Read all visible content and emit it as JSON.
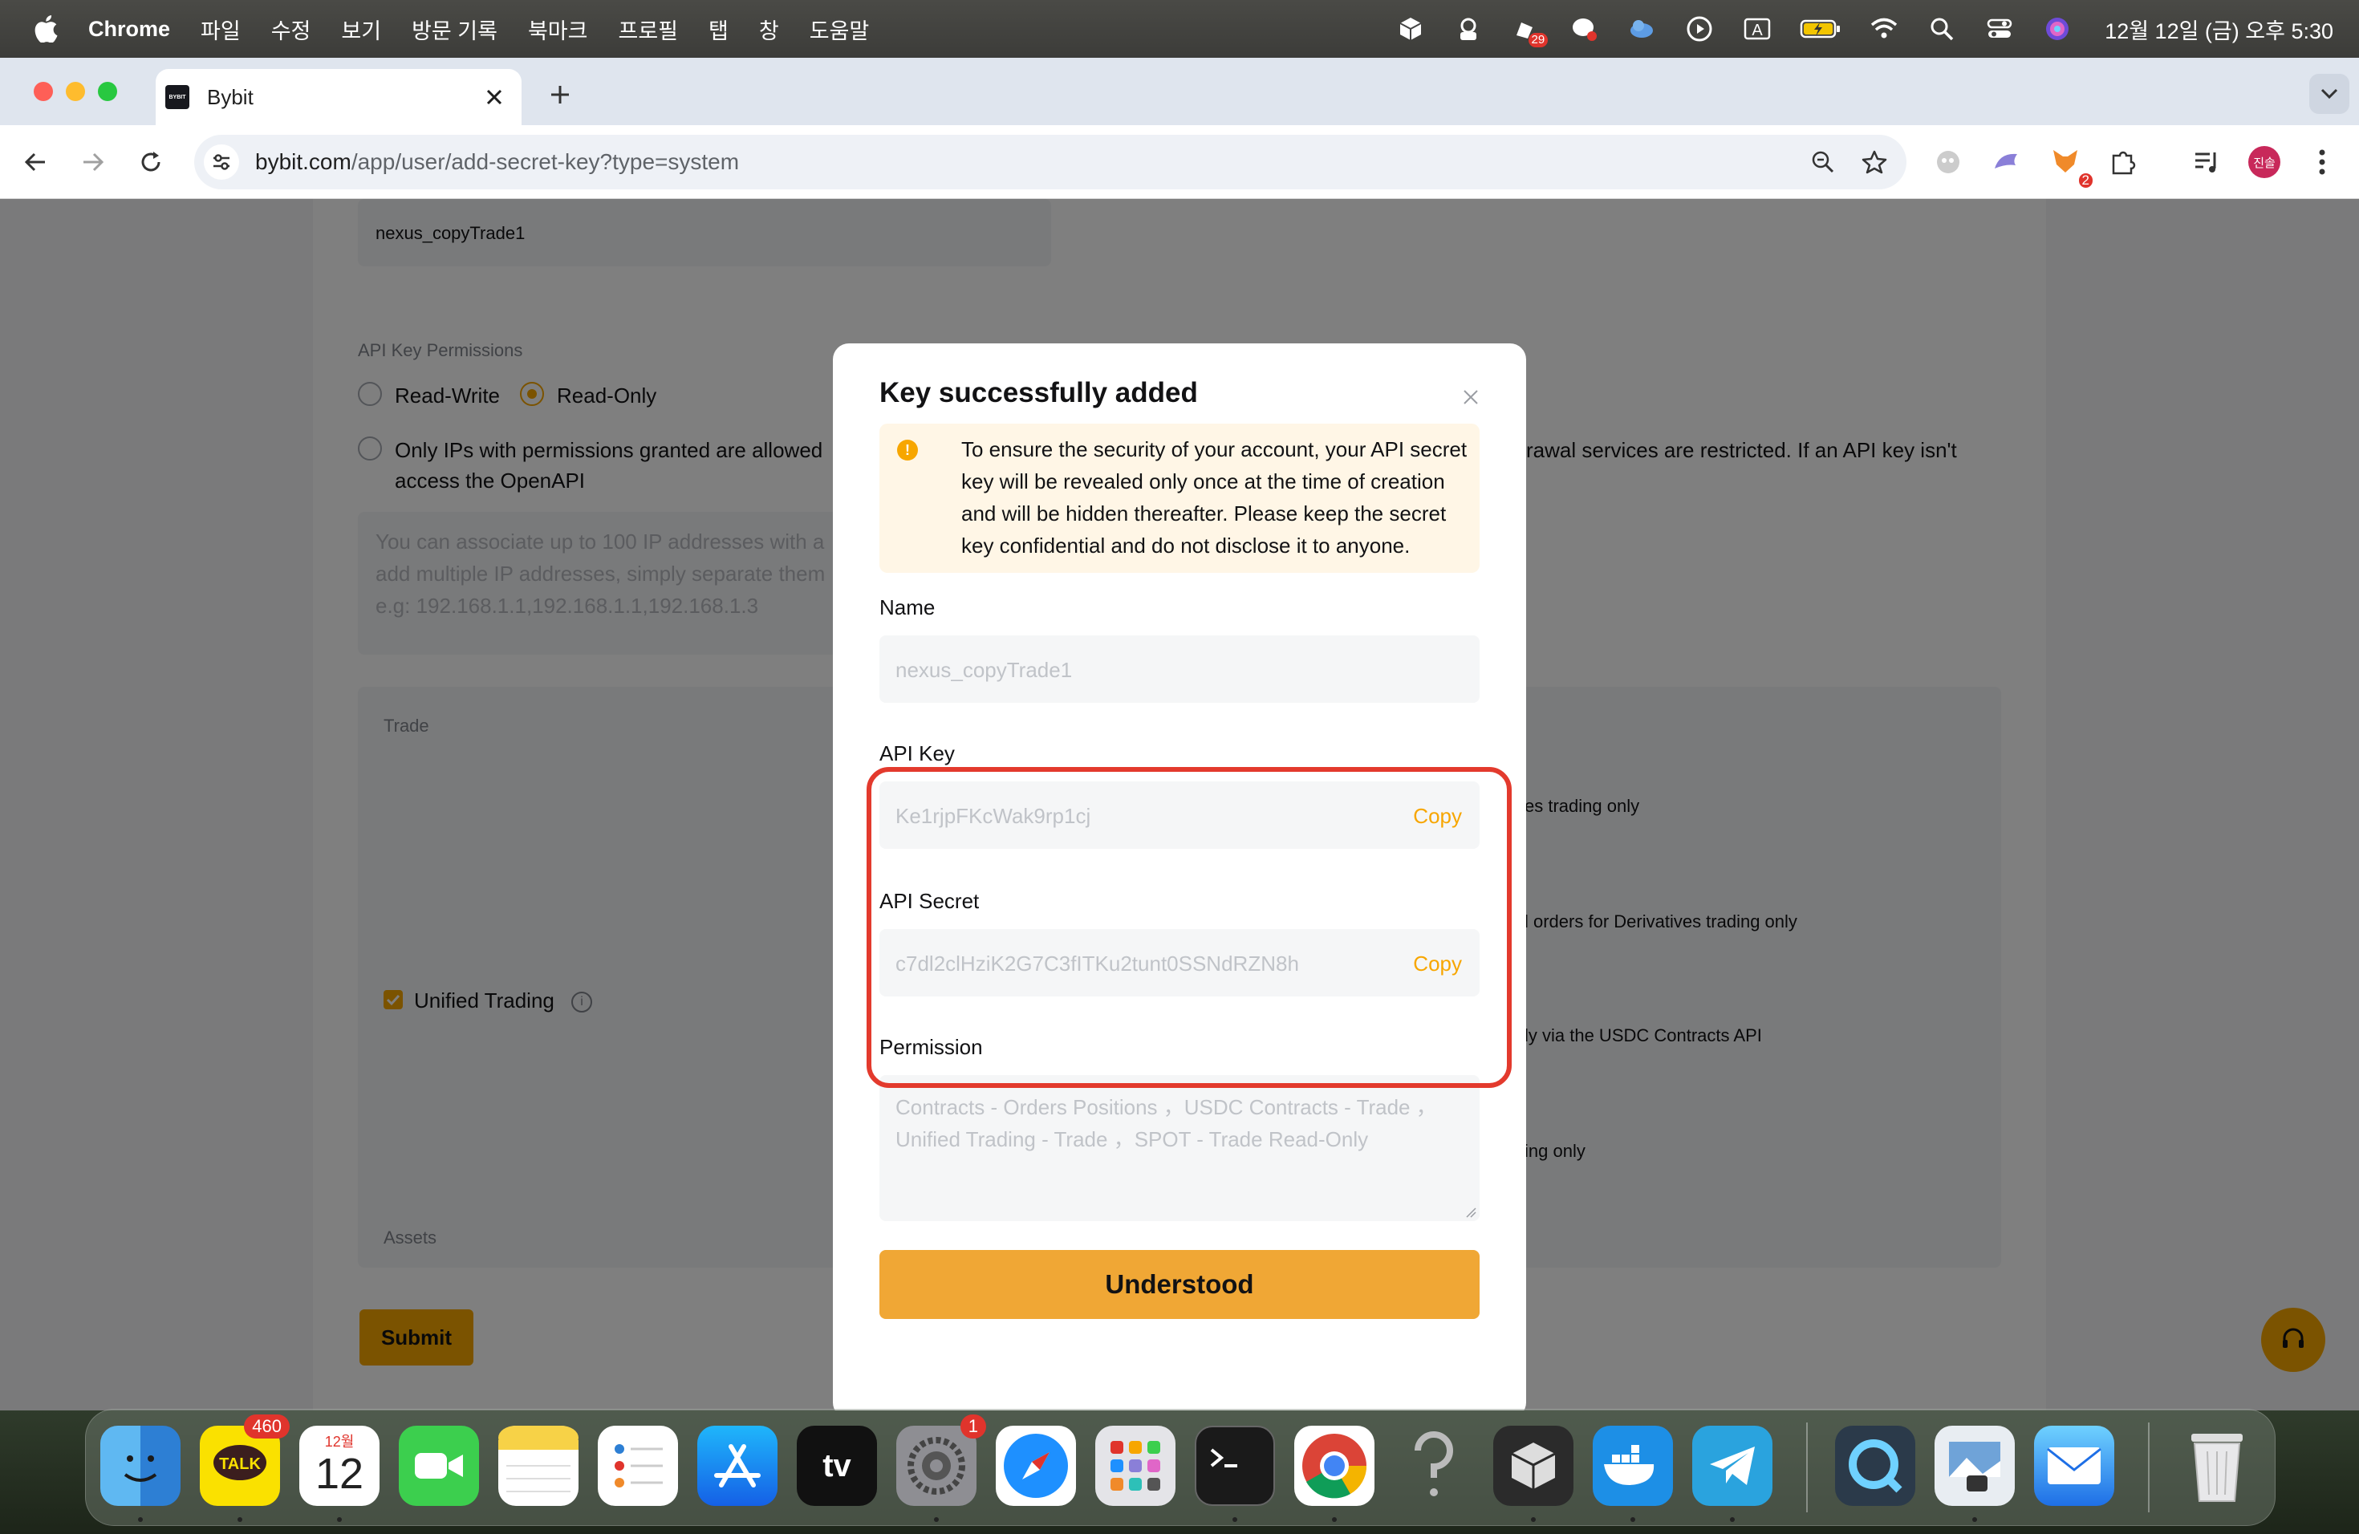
{
  "menubar": {
    "app_name": "Chrome",
    "menus": [
      "파일",
      "수정",
      "보기",
      "방문 기록",
      "북마크",
      "프로필",
      "탭",
      "창",
      "도움말"
    ],
    "status_icons": [
      "box-icon",
      "puppet-icon",
      "notification-icon",
      "chat-icon",
      "cloud-icon",
      "play-icon",
      "input-source-icon",
      "battery-icon",
      "wifi-icon",
      "spotlight-icon",
      "control-center-icon",
      "siri-icon"
    ],
    "notification_badge": "29",
    "input_source": "A",
    "clock": "12월 12일 (금) 오후 5:30"
  },
  "browser": {
    "tab_title": "Bybit",
    "url_host": "bybit.com",
    "url_path": "/app/user/add-secret-key?type=system",
    "extension_badge": "2",
    "profile_initials": "진솔"
  },
  "page": {
    "name_value": "nexus_copyTrade1",
    "permissions_label": "API Key Permissions",
    "read_write_label": "Read-Write",
    "read_only_label": "Read-Only",
    "ip_option_text_1": "Only IPs with permissions granted are allowed",
    "ip_option_text_2": "access the OpenAPI",
    "ip_right_text": "rawal services are restricted. If an API key isn't",
    "ip_placeholder_1": "You can associate up to 100 IP addresses with a",
    "ip_placeholder_2": "add multiple IP addresses, simply separate them",
    "ip_placeholder_3": "e.g: 192.168.1.1,192.168.1.1,192.168.1.3",
    "trade_label": "Trade",
    "assets_label": "Assets",
    "unified_trading_label": "Unified Trading",
    "right_text_1": "es trading only",
    "right_text_2": "l orders for Derivatives trading only",
    "right_text_3": "ly via the USDC Contracts API",
    "right_text_4": "ing only",
    "submit_label": "Submit"
  },
  "modal": {
    "title": "Key successfully added",
    "notice": "To ensure the security of your account, your API secret key will be revealed only once at the time of creation and will be hidden thereafter. Please keep the secret key confidential and do not disclose it to anyone.",
    "name_label": "Name",
    "name_value": "nexus_copyTrade1",
    "api_key_label": "API Key",
    "api_key_value": "Ke1rjpFKcWak9rp1cj",
    "api_secret_label": "API Secret",
    "api_secret_value": "c7dl2clHziK2G7C3fITKu2tunt0SSNdRZN8h",
    "copy_label": "Copy",
    "permission_label": "Permission",
    "permission_value": "Contracts - Orders Positions ，USDC Contracts - Trade ，Unified Trading - Trade ，SPOT - Trade  Read-Only",
    "understood_label": "Understood"
  },
  "dock": {
    "apps": [
      "Finder",
      "KakaoTalk",
      "Calendar",
      "FaceTime",
      "Notes",
      "Reminders",
      "App Store",
      "Apple TV",
      "System Settings",
      "Safari",
      "Launchpad",
      "Terminal",
      "Google Chrome",
      "Unknown",
      "Parallels",
      "Docker",
      "Telegram",
      "QuickTime",
      "Preview",
      "Mail",
      "Trash"
    ],
    "kakao_badge": "460",
    "calendar_month": "12월",
    "calendar_day": "12",
    "settings_badge": "1",
    "tv_label": "tv"
  },
  "colors": {
    "accent": "#f7a600",
    "highlight": "#e33a2d"
  }
}
